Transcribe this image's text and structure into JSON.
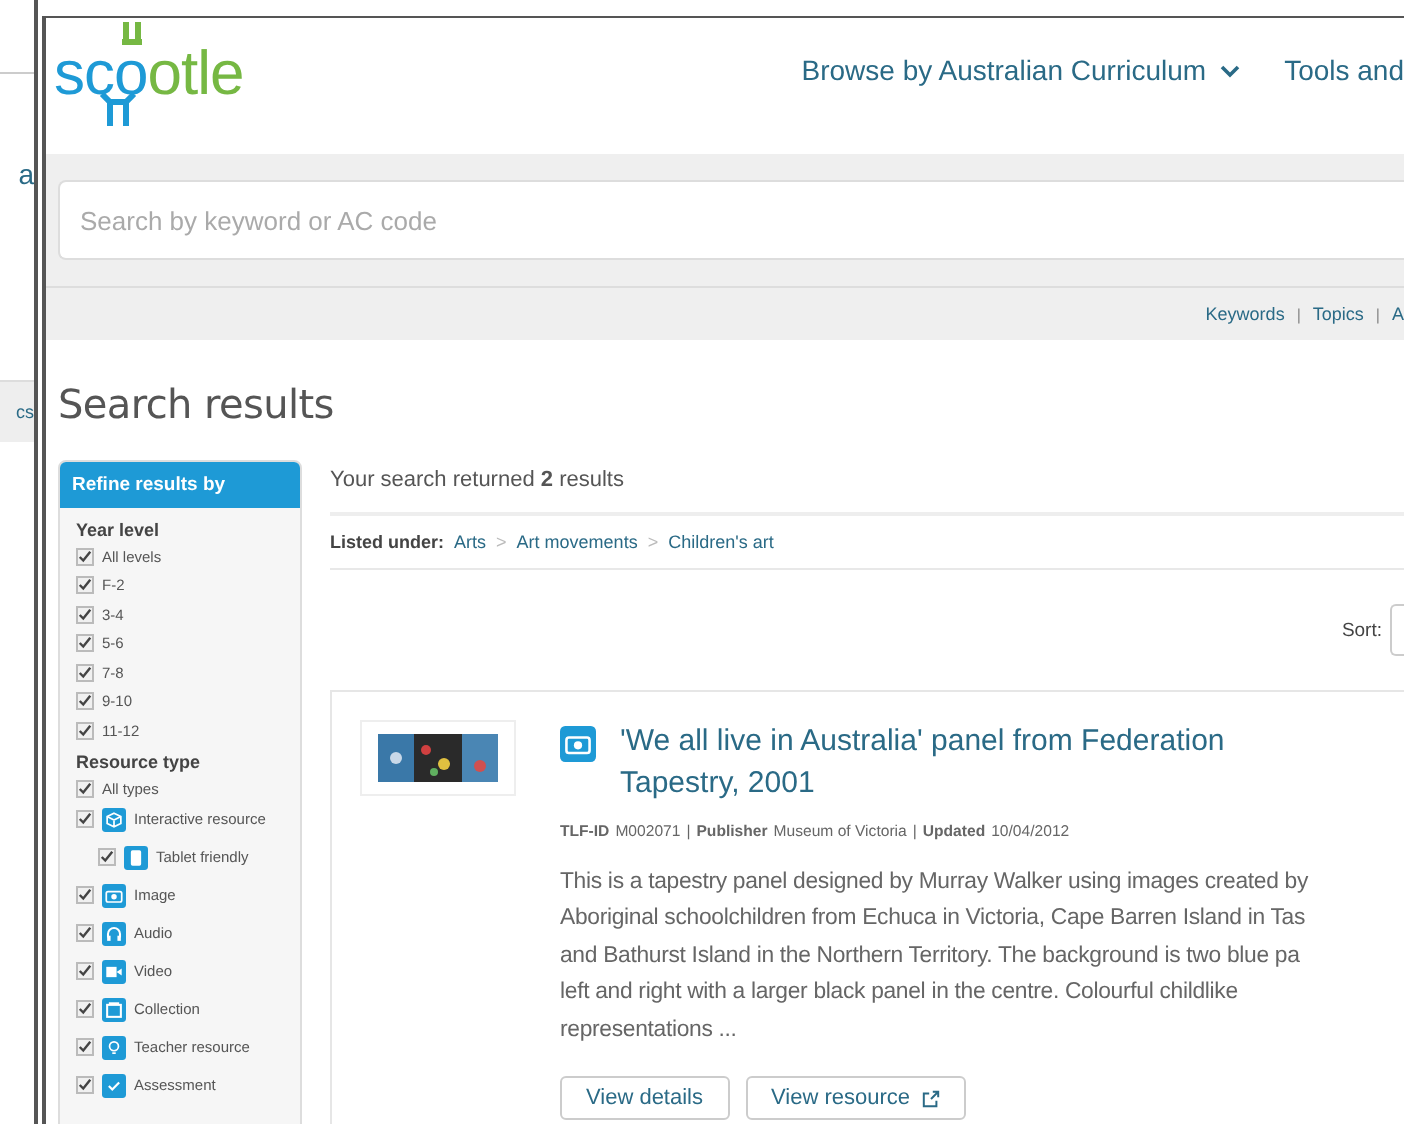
{
  "side_window": {
    "texts": [
      "a",
      "cs"
    ]
  },
  "logo": {
    "parts": [
      {
        "text": "sco",
        "color": "#1e9ad6"
      },
      {
        "text": "otle",
        "color": "#76b843"
      }
    ]
  },
  "nav": [
    {
      "label": "Browse by Australian Curriculum",
      "dropdown": true
    },
    {
      "label": "Tools and",
      "dropdown": false
    }
  ],
  "search": {
    "placeholder": "Search by keyword or AC code"
  },
  "search_links": [
    "Keywords",
    "Topics",
    "A"
  ],
  "search_link_separator": "|",
  "page_title": "Search results",
  "sidebar": {
    "header": "Refine results by",
    "sections": [
      {
        "title": "Year level",
        "items": [
          {
            "label": "All levels",
            "checked": true,
            "kind": "plain"
          },
          {
            "label": "F-2",
            "checked": true,
            "kind": "plain"
          },
          {
            "label": "3-4",
            "checked": true,
            "kind": "plain"
          },
          {
            "label": "5-6",
            "checked": true,
            "kind": "plain"
          },
          {
            "label": "7-8",
            "checked": true,
            "kind": "plain"
          },
          {
            "label": "9-10",
            "checked": true,
            "kind": "plain"
          },
          {
            "label": "11-12",
            "checked": true,
            "kind": "plain"
          }
        ]
      },
      {
        "title": "Resource type",
        "items": [
          {
            "label": "All types",
            "checked": true,
            "kind": "plain"
          },
          {
            "label": "Interactive resource",
            "checked": true,
            "kind": "interactive",
            "children": [
              {
                "label": "Tablet friendly",
                "checked": true,
                "kind": "tablet"
              }
            ]
          },
          {
            "label": "Image",
            "checked": true,
            "kind": "image"
          },
          {
            "label": "Audio",
            "checked": true,
            "kind": "audio"
          },
          {
            "label": "Video",
            "checked": true,
            "kind": "video"
          },
          {
            "label": "Collection",
            "checked": true,
            "kind": "collection"
          },
          {
            "label": "Teacher resource",
            "checked": true,
            "kind": "teacher"
          },
          {
            "label": "Assessment",
            "checked": true,
            "kind": "assessment"
          }
        ]
      }
    ]
  },
  "results_summary": "Your search returned **2** results",
  "listed_under": {
    "label": "Listed under:",
    "crumbs": [
      "Arts",
      "Art movements",
      "Children's art"
    ],
    "separator": ">"
  },
  "sort": {
    "label": "Sort:"
  },
  "results": [
    {
      "kind": "image",
      "title": "'We all live in Australia' panel from Federation Tapestry, 2001",
      "meta_separator": "|",
      "meta": [
        {
          "label": "TLF-ID",
          "value": "M002071"
        },
        {
          "label": "Publisher",
          "value": "Museum of Victoria"
        },
        {
          "label": "Updated",
          "value": "10/04/2012"
        }
      ],
      "description_lines": [
        "This is a tapestry panel designed by Murray Walker using images created by",
        "Aboriginal schoolchildren from Echuca in Victoria, Cape Barren Island in Tas",
        "and Bathurst Island in the Northern Territory. The background is two blue pa",
        "left and right with a larger black panel in the centre. Colourful childlike",
        "representations ..."
      ],
      "buttons": [
        {
          "label": "View details",
          "external": false
        },
        {
          "label": "View resource",
          "external": true
        }
      ]
    }
  ]
}
